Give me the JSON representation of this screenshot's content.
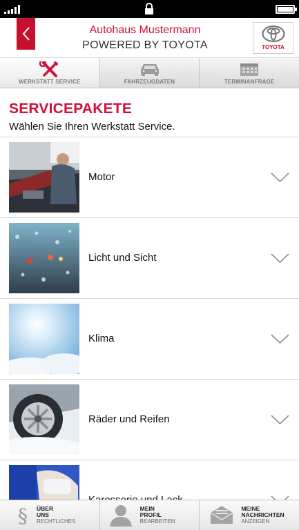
{
  "header": {
    "title": "Autohaus Mustermann",
    "subtitle": "POWERED BY TOYOTA",
    "logo_text": "TOYOTA"
  },
  "tabs": [
    {
      "label": "WERKSTATT SERVICE",
      "icon": "wrench-screwdriver-icon",
      "active": true
    },
    {
      "label": "FAHRZEUGDATEN",
      "icon": "car-icon",
      "active": false
    },
    {
      "label": "TERMINANFRAGE",
      "icon": "calendar-icon",
      "active": false
    }
  ],
  "section": {
    "title": "SERVICEPAKETE",
    "subtitle": "Wählen Sie Ihren Werkstatt Service."
  },
  "services": [
    {
      "label": "Motor"
    },
    {
      "label": "Licht und Sicht"
    },
    {
      "label": "Klima"
    },
    {
      "label": "Räder und Reifen"
    },
    {
      "label": "Karosserie und Lack"
    }
  ],
  "bottom_nav": [
    {
      "line1": "ÜBER",
      "line2": "UNS",
      "line3": "RECHTLICHES",
      "icon": "paragraph-icon"
    },
    {
      "line1": "MEIN",
      "line2": "PROFIL",
      "line3": "BEARBEITEN",
      "icon": "user-icon"
    },
    {
      "line1": "MEINE",
      "line2": "NACHRICHTEN",
      "line3": "ANZEIGEN",
      "icon": "envelope-icon"
    }
  ],
  "colors": {
    "accent": "#d0103a",
    "brand_red": "#c8102e"
  }
}
